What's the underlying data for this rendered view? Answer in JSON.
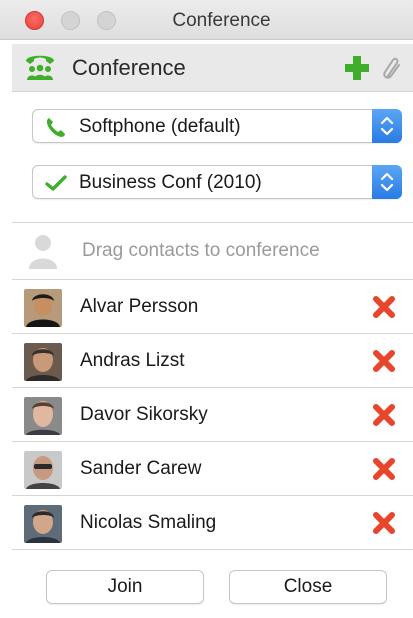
{
  "window": {
    "title": "Conference"
  },
  "header": {
    "title": "Conference"
  },
  "phone_select": {
    "value": "Softphone (default)"
  },
  "bridge_select": {
    "value": "Business Conf (2010)"
  },
  "drag_area": {
    "text": "Drag contacts to conference"
  },
  "participants": [
    {
      "name": "Alvar Persson"
    },
    {
      "name": "Andras Lizst"
    },
    {
      "name": "Davor Sikorsky"
    },
    {
      "name": "Sander Carew"
    },
    {
      "name": "Nicolas Smaling"
    }
  ],
  "footer": {
    "join_label": "Join",
    "close_label": "Close"
  },
  "colors": {
    "accent_green": "#3fae2a",
    "remove_red": "#e8452c",
    "stepper_blue": "#2a7be4"
  },
  "icons": [
    "conference-icon",
    "plus-icon",
    "paperclip-icon",
    "phone-icon",
    "checkmark-icon",
    "person-placeholder-icon",
    "remove-icon"
  ]
}
